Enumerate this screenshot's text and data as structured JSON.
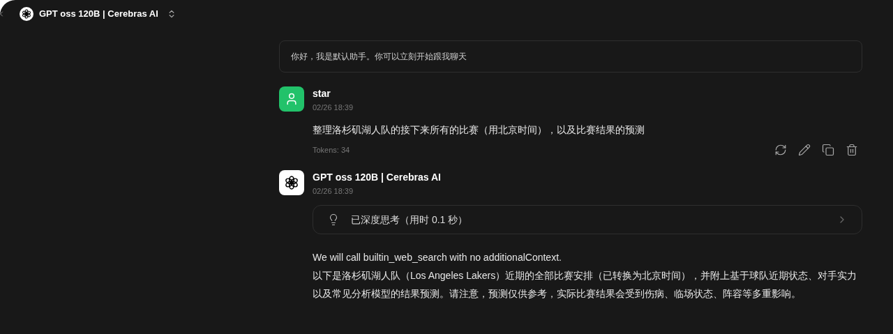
{
  "header": {
    "model": "GPT oss 120B | Cerebras AI"
  },
  "welcome": "你好，我是默认助手。你可以立刻开始跟我聊天",
  "messages": [
    {
      "kind": "user",
      "author": "star",
      "time": "02/26 18:39",
      "text": "整理洛杉矶湖人队的接下来所有的比赛（用北京时间），以及比赛结果的预测",
      "tokens": "Tokens: 34"
    },
    {
      "kind": "assistant",
      "author": "GPT oss 120B | Cerebras AI",
      "time": "02/26 18:39",
      "thinking": {
        "label": "已深度思考（用时 0.1 秒）",
        "expanded": false
      },
      "paragraphs": [
        "We will call builtin_web_search with no additionalContext.",
        "以下是洛杉矶湖人队（Los Angeles Lakers）近期的全部比赛安排（已转换为北京时间），并附上基于球队近期状态、对手实力以及常见分析模型的结果预测。请注意，预测仅供参考，实际比赛结果会受到伤病、临场状态、阵容等多重影响。"
      ]
    }
  ]
}
